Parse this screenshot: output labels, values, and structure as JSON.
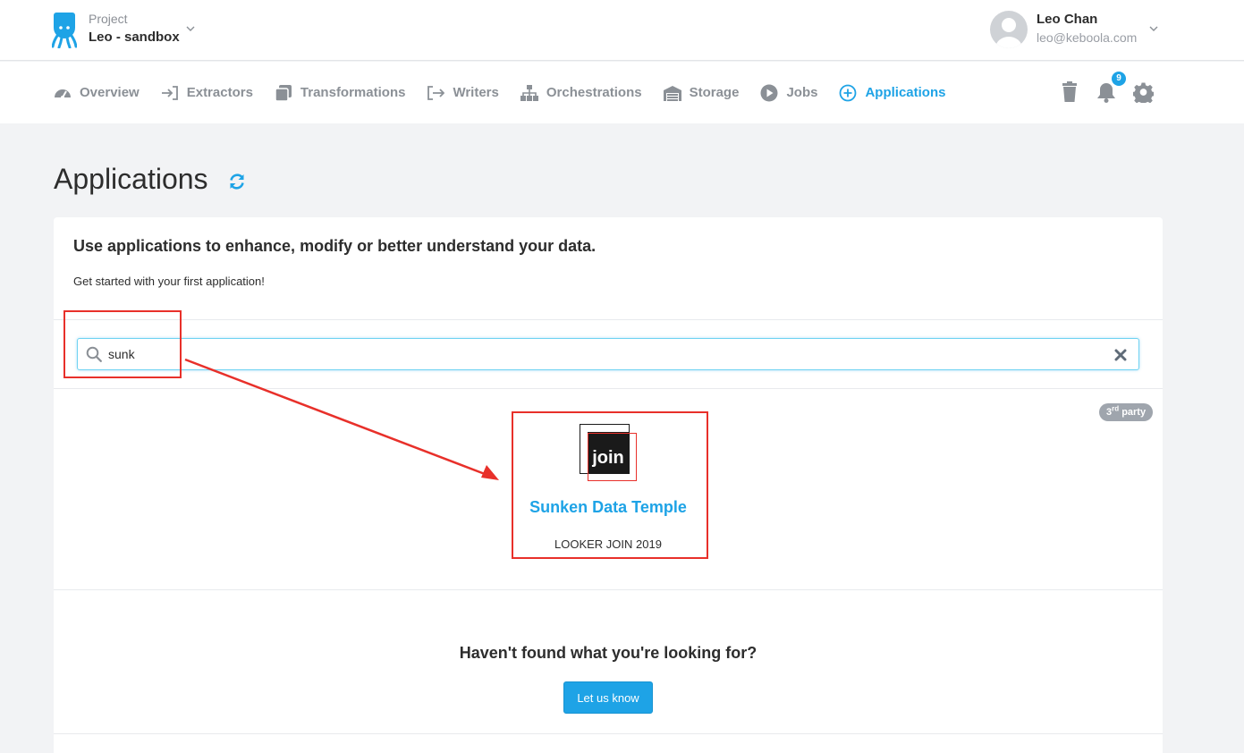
{
  "header": {
    "project_label": "Project",
    "project_name": "Leo - sandbox",
    "user_name": "Leo Chan",
    "user_email": "leo@keboola.com"
  },
  "nav": {
    "items": [
      {
        "label": "Overview",
        "icon": "dashboard-icon"
      },
      {
        "label": "Extractors",
        "icon": "sign-in-icon"
      },
      {
        "label": "Transformations",
        "icon": "copy-icon"
      },
      {
        "label": "Writers",
        "icon": "sign-out-icon"
      },
      {
        "label": "Orchestrations",
        "icon": "sitemap-icon"
      },
      {
        "label": "Storage",
        "icon": "warehouse-icon"
      },
      {
        "label": "Jobs",
        "icon": "play-circle-icon"
      },
      {
        "label": "Applications",
        "icon": "plus-circle-icon",
        "active": true
      }
    ],
    "notifications_count": "9"
  },
  "page": {
    "title": "Applications"
  },
  "intro": {
    "heading": "Use applications to enhance, modify or better understand your data.",
    "text": "Get started with your first application!"
  },
  "search": {
    "value": "sunk",
    "placeholder": ""
  },
  "results": [
    {
      "name": "Sunken Data Temple",
      "vendor": "LOOKER JOIN 2019",
      "badge_sup": "rd",
      "badge_num": "3",
      "badge_text": "party",
      "logo_text": "join"
    }
  ],
  "footer": {
    "question": "Haven't found what you're looking for?",
    "button_label": "Let us know"
  },
  "colors": {
    "accent": "#1ea3e6",
    "annotation": "#e8302a"
  }
}
